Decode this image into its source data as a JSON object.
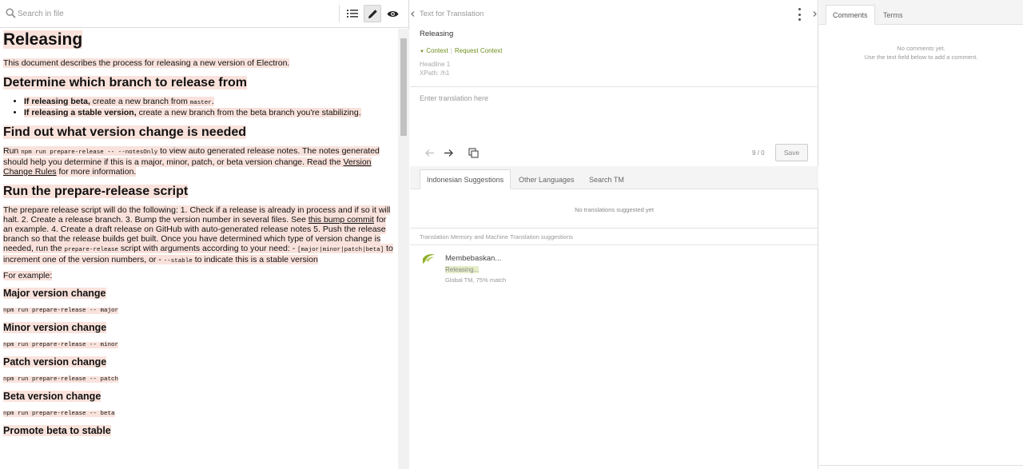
{
  "left_toolbar": {
    "search_placeholder": "Search in file"
  },
  "document": {
    "title": "Releasing",
    "intro": "This document describes the process for releasing a new version of Electron.",
    "s1_heading": "Determine which branch to release from",
    "s1_items": [
      {
        "bold": "If releasing beta,",
        "text_a": " create a new branch from ",
        "code": "master",
        "text_b": "."
      },
      {
        "bold": "If releasing a stable version,",
        "text_a": " create a new branch from the beta branch you're stabilizing.",
        "code": "",
        "text_b": ""
      }
    ],
    "s2_heading": "Find out what version change is needed",
    "s2_p_a": "Run ",
    "s2_code": "npm run prepare-release -- --notesOnly",
    "s2_p_b": " to view auto generated release notes. The notes generated should help you determine if this is a major, minor, patch, or beta version change. Read the ",
    "s2_link": "Version Change Rules",
    "s2_p_c": " for more information.",
    "s3_heading": "Run the prepare-release script",
    "s3_p_a": "The prepare release script will do the following: 1. Check if a release is already in process and if so it will halt. 2. Create a release branch. 3. Bump the version number in several files. See ",
    "s3_link": "this bump commit",
    "s3_p_b": " for an example. 4. Create a draft release on GitHub with auto-generated release notes 5. Push the release branch so that the release builds get built. Once you have determined which type of version change is needed, run the ",
    "s3_code1": "prepare-release",
    "s3_p_c": " script with arguments according to your need: - ",
    "s3_code2": "[major|minor|patch|beta]",
    "s3_p_d": " to increment one of the version numbers, or - ",
    "s3_code3": "--stable",
    "s3_p_e": " to indicate this is a stable version",
    "for_example": "For example:",
    "examples": [
      {
        "heading": "Major version change",
        "code": "npm run prepare-release -- major"
      },
      {
        "heading": "Minor version change",
        "code": "npm run prepare-release -- minor"
      },
      {
        "heading": "Patch version change",
        "code": "npm run prepare-release -- patch"
      },
      {
        "heading": "Beta version change",
        "code": "npm run prepare-release -- beta"
      }
    ],
    "last_heading": "Promote beta to stable"
  },
  "editor": {
    "header_title": "Text for Translation",
    "source_text": "Releasing",
    "context_label": "Context",
    "request_context_label": "Request Context",
    "headline": "Headline 1",
    "xpath": "XPath: /h1",
    "translation_placeholder": "Enter translation here",
    "char_count": "9 / 0",
    "save_label": "Save"
  },
  "suggestions": {
    "tabs": [
      "Indonesian Suggestions",
      "Other Languages",
      "Search TM"
    ],
    "empty_text": "No translations suggested yet",
    "tm_header": "Translation Memory and Machine Translation suggestions",
    "tm_item": {
      "target": "Membebaskan...",
      "source": "Releasing...",
      "meta": "Global TM, 75% match"
    }
  },
  "comments": {
    "tabs": [
      "Comments",
      "Terms"
    ],
    "empty_line1": "No comments yet.",
    "empty_line2": "Use the text field below to add a comment."
  },
  "colors": {
    "highlight": "#f9e2dc",
    "context_green": "#6d8f1e"
  }
}
